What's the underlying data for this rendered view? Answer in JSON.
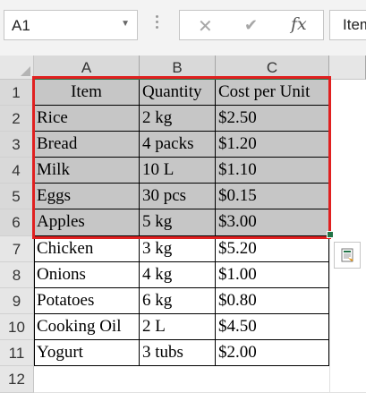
{
  "formula_bar": {
    "name_box": "A1",
    "formula_value": "Item",
    "fx_label": "fx"
  },
  "columns": [
    "A",
    "B",
    "C"
  ],
  "rows": [
    "1",
    "2",
    "3",
    "4",
    "5",
    "6",
    "7",
    "8",
    "9",
    "10",
    "11",
    "12"
  ],
  "table": {
    "headers": [
      "Item",
      "Quantity",
      "Cost per Unit"
    ],
    "data": [
      [
        "Rice",
        "2 kg",
        "$2.50"
      ],
      [
        "Bread",
        "4 packs",
        "$1.20"
      ],
      [
        "Milk",
        "10 L",
        "$1.10"
      ],
      [
        "Eggs",
        "30 pcs",
        "$0.15"
      ],
      [
        "Apples",
        "5 kg",
        "$3.00"
      ],
      [
        "Chicken",
        "3 kg",
        "$5.20"
      ],
      [
        "Onions",
        "4 kg",
        "$1.00"
      ],
      [
        "Potatoes",
        "6 kg",
        "$0.80"
      ],
      [
        "Cooking Oil",
        "2 L",
        "$4.50"
      ],
      [
        "Yogurt",
        "3 tubs",
        "$2.00"
      ]
    ]
  },
  "colors": {
    "selection_border": "#e02020",
    "selection_fill": "#c6c6c6",
    "excel_green": "#217346"
  }
}
